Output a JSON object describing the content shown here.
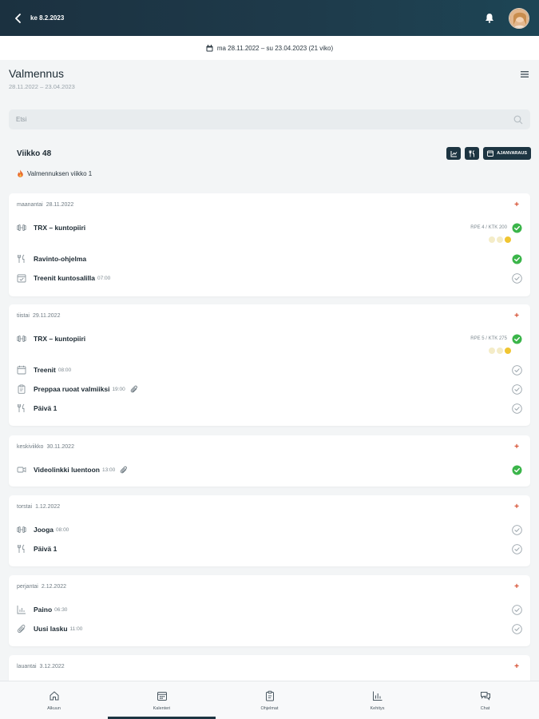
{
  "header": {
    "title": "ke 8.2.2023"
  },
  "range": {
    "label": "ma 28.11.2022 – su 23.04.2023 (21 viko)"
  },
  "program": {
    "title": "Valmennus",
    "dates": "28.11.2022 – 23.04.2023"
  },
  "search": {
    "placeholder": "Etsi"
  },
  "week": {
    "title": "Viikko 48",
    "note": "Valmennuksen viikko 1",
    "schedule_label": "AJANVARAUS"
  },
  "days": [
    {
      "weekday": "maanantai",
      "date": "28.11.2022",
      "entries": [
        {
          "icon": "dumbbell",
          "name": "TRX – kuntopiiri",
          "time": "",
          "rpe": "RPE 4 / KTK 200",
          "faces": [
            false,
            false,
            true
          ],
          "status": "done"
        },
        {
          "icon": "fork-knife",
          "name": "Ravinto-ohjelma",
          "time": "",
          "status": "done"
        },
        {
          "icon": "calendar-check",
          "name": "Treenit kuntosalilla",
          "time": "07:00",
          "status": "open"
        }
      ]
    },
    {
      "weekday": "tiistai",
      "date": "29.11.2022",
      "entries": [
        {
          "icon": "dumbbell",
          "name": "TRX – kuntopiiri",
          "time": "",
          "rpe": "RPE 5 / KTK 275",
          "faces": [
            false,
            false,
            true
          ],
          "status": "done"
        },
        {
          "icon": "calendar",
          "name": "Treenit",
          "time": "08:00",
          "status": "open"
        },
        {
          "icon": "clipboard",
          "name": "Preppaa ruoat valmiiksi",
          "time": "19:00",
          "clip": true,
          "status": "open"
        },
        {
          "icon": "fork-knife",
          "name": "Päivä 1",
          "time": "",
          "status": "open"
        }
      ]
    },
    {
      "weekday": "keskiviikko",
      "date": "30.11.2022",
      "entries": [
        {
          "icon": "video",
          "name": "Videolinkki luentoon",
          "time": "13:00",
          "clip": true,
          "status": "done"
        }
      ]
    },
    {
      "weekday": "torstai",
      "date": "1.12.2022",
      "entries": [
        {
          "icon": "dumbbell",
          "name": "Jooga",
          "time": "08:00",
          "status": "open"
        },
        {
          "icon": "fork-knife",
          "name": "Päivä 1",
          "time": "",
          "status": "open"
        }
      ]
    },
    {
      "weekday": "perjantai",
      "date": "2.12.2022",
      "entries": [
        {
          "icon": "chart",
          "name": "Paino",
          "time": "06:30",
          "status": "open"
        },
        {
          "icon": "paperclip",
          "name": "Uusi lasku",
          "time": "11:00",
          "status": "open"
        }
      ]
    },
    {
      "weekday": "lauantai",
      "date": "3.12.2022",
      "entries": []
    }
  ],
  "tabs": [
    {
      "label": "Alkuun",
      "icon": "home",
      "active": false
    },
    {
      "label": "Kalenteri",
      "icon": "calendar",
      "active": true
    },
    {
      "label": "Ohjelmat",
      "icon": "clipboard",
      "active": false
    },
    {
      "label": "Kehitys",
      "icon": "chart",
      "active": false
    },
    {
      "label": "Chat",
      "icon": "chat",
      "active": false
    }
  ],
  "colors": {
    "header": "#1b3140",
    "accent": "#d44a2b",
    "done": "#3bb54a",
    "button": "#1d3542"
  }
}
